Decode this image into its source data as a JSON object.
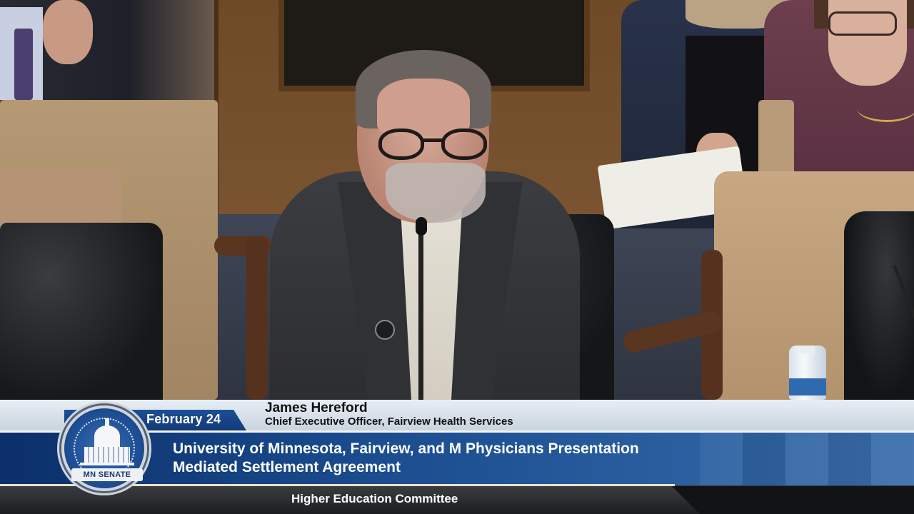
{
  "broadcast": {
    "date": "February 24",
    "speaker_name": "James Hereford",
    "speaker_title": "Chief Executive Officer, Fairview Health Services",
    "program_line1": "University of Minnesota, Fairview, and M Physicians Presentation",
    "program_line2": "Mediated Settlement Agreement",
    "committee": "Higher Education Committee",
    "seal_text": "MN SENATE"
  },
  "colors": {
    "banner_blue": "#1a4c8e",
    "date_tab_blue": "#123a78",
    "light_band": "#e7eef5",
    "dark_band": "#111315"
  }
}
